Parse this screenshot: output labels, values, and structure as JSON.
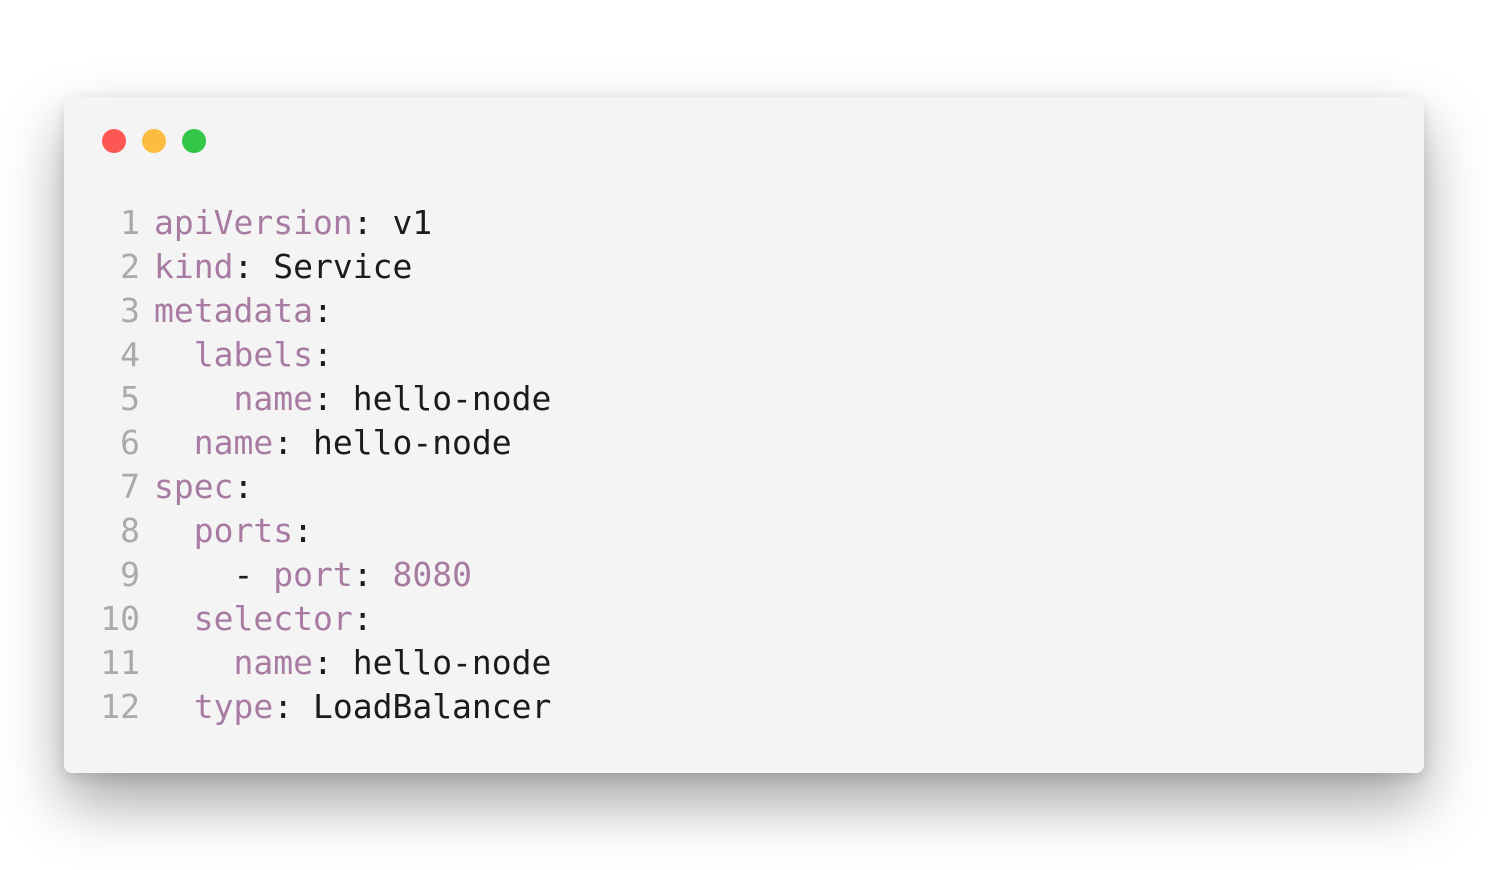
{
  "window": {
    "controls": {
      "close_color": "#fc5753",
      "minimize_color": "#fdbc40",
      "zoom_color": "#33c748"
    }
  },
  "editor": {
    "language": "yaml",
    "colors": {
      "key": "#a77ba2",
      "number": "#a77ba2",
      "text": "#1b1b1b",
      "line_number": "#aaaaaa",
      "background": "#f4f4f4"
    },
    "lines": [
      {
        "n": "1",
        "indent": "",
        "dash": "",
        "key": "apiVersion",
        "sep": ":",
        "value": "v1",
        "value_type": "text"
      },
      {
        "n": "2",
        "indent": "",
        "dash": "",
        "key": "kind",
        "sep": ":",
        "value": "Service",
        "value_type": "text"
      },
      {
        "n": "3",
        "indent": "",
        "dash": "",
        "key": "metadata",
        "sep": ":",
        "value": "",
        "value_type": "text"
      },
      {
        "n": "4",
        "indent": "  ",
        "dash": "",
        "key": "labels",
        "sep": ":",
        "value": "",
        "value_type": "text"
      },
      {
        "n": "5",
        "indent": "    ",
        "dash": "",
        "key": "name",
        "sep": ":",
        "value": "hello-node",
        "value_type": "text"
      },
      {
        "n": "6",
        "indent": "  ",
        "dash": "",
        "key": "name",
        "sep": ":",
        "value": "hello-node",
        "value_type": "text"
      },
      {
        "n": "7",
        "indent": "",
        "dash": "",
        "key": "spec",
        "sep": ":",
        "value": "",
        "value_type": "text"
      },
      {
        "n": "8",
        "indent": "  ",
        "dash": "",
        "key": "ports",
        "sep": ":",
        "value": "",
        "value_type": "text"
      },
      {
        "n": "9",
        "indent": "    ",
        "dash": "- ",
        "key": "port",
        "sep": ":",
        "value": "8080",
        "value_type": "number"
      },
      {
        "n": "10",
        "indent": "  ",
        "dash": "",
        "key": "selector",
        "sep": ":",
        "value": "",
        "value_type": "text"
      },
      {
        "n": "11",
        "indent": "    ",
        "dash": "",
        "key": "name",
        "sep": ":",
        "value": "hello-node",
        "value_type": "text"
      },
      {
        "n": "12",
        "indent": "  ",
        "dash": "",
        "key": "type",
        "sep": ":",
        "value": "LoadBalancer",
        "value_type": "text"
      }
    ]
  }
}
